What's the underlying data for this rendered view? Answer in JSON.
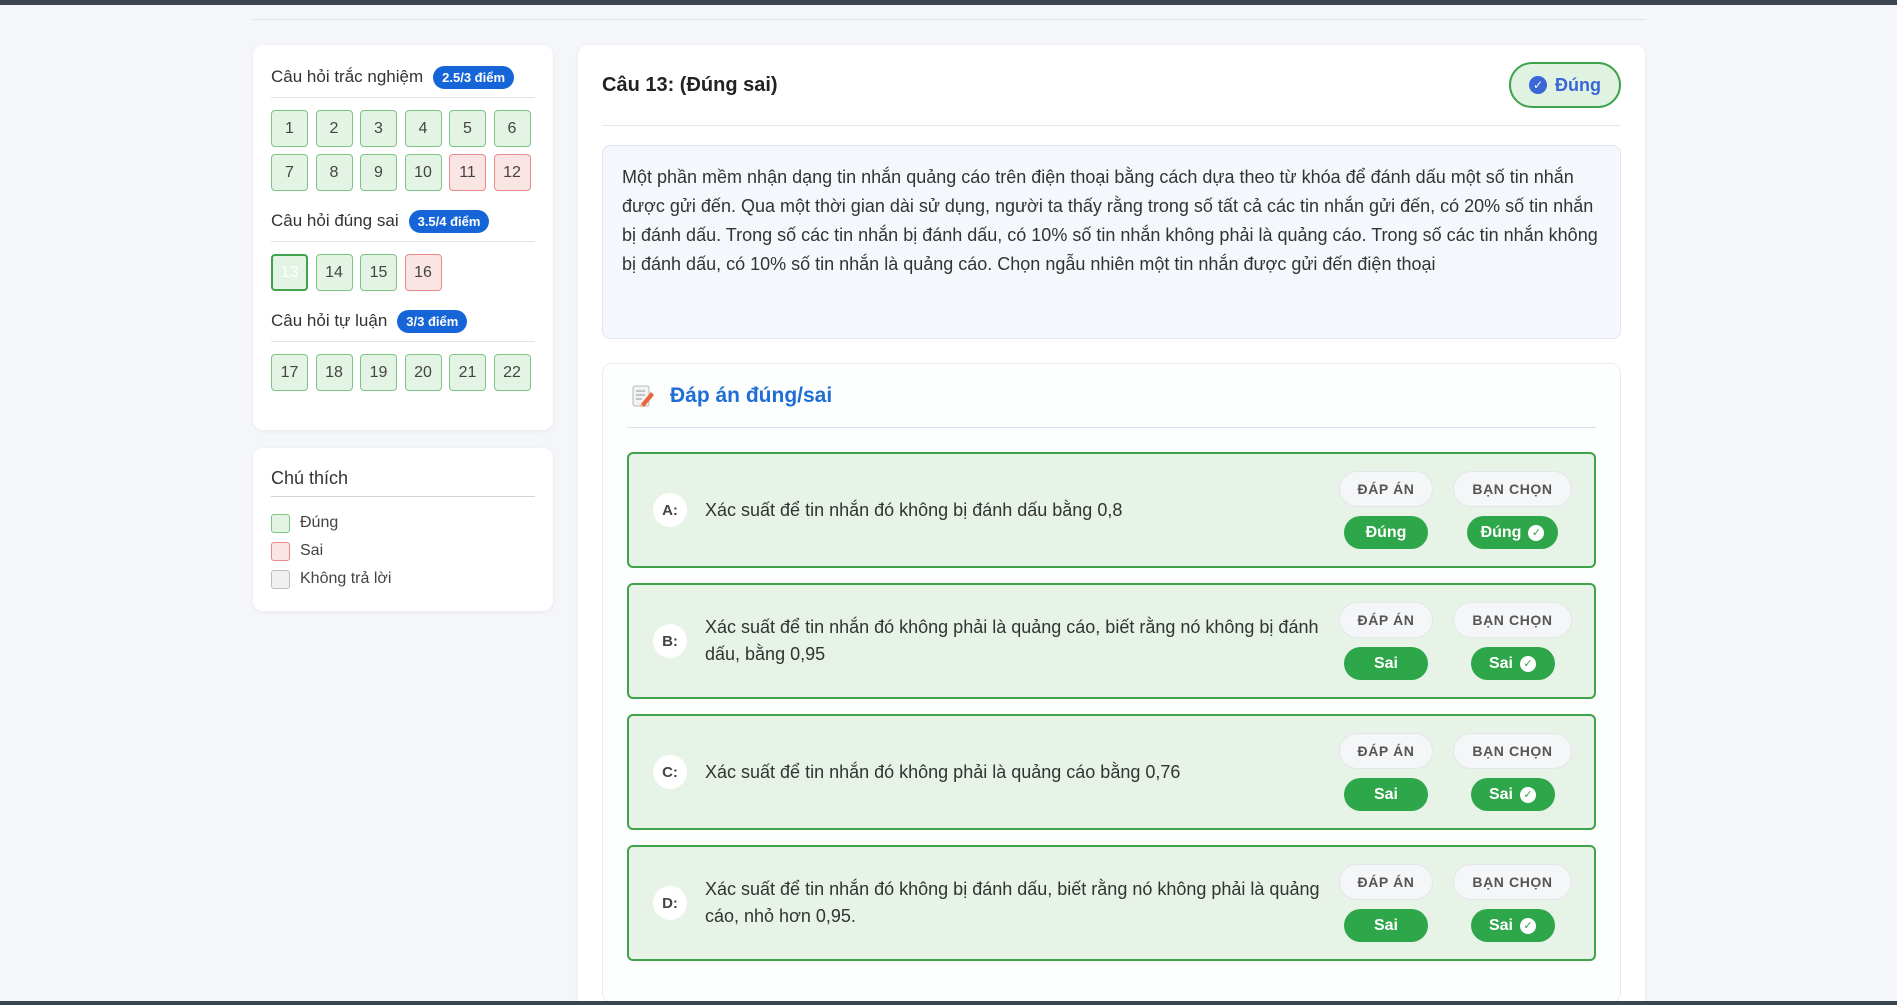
{
  "sidebar": {
    "sections": [
      {
        "title": "Câu hỏi trắc nghiệm",
        "badge": "2.5/3 điểm",
        "items": [
          {
            "label": "1",
            "state": "correct"
          },
          {
            "label": "2",
            "state": "correct"
          },
          {
            "label": "3",
            "state": "correct"
          },
          {
            "label": "4",
            "state": "correct"
          },
          {
            "label": "5",
            "state": "correct"
          },
          {
            "label": "6",
            "state": "correct"
          },
          {
            "label": "7",
            "state": "correct"
          },
          {
            "label": "8",
            "state": "correct"
          },
          {
            "label": "9",
            "state": "correct"
          },
          {
            "label": "10",
            "state": "correct"
          },
          {
            "label": "11",
            "state": "wrong"
          },
          {
            "label": "12",
            "state": "wrong"
          }
        ]
      },
      {
        "title": "Câu hỏi đúng sai",
        "badge": "3.5/4 điểm",
        "items": [
          {
            "label": "13",
            "state": "current"
          },
          {
            "label": "14",
            "state": "correct"
          },
          {
            "label": "15",
            "state": "correct"
          },
          {
            "label": "16",
            "state": "wrong"
          }
        ]
      },
      {
        "title": "Câu hỏi tự luận",
        "badge": "3/3 điểm",
        "items": [
          {
            "label": "17",
            "state": "correct"
          },
          {
            "label": "18",
            "state": "correct"
          },
          {
            "label": "19",
            "state": "correct"
          },
          {
            "label": "20",
            "state": "correct"
          },
          {
            "label": "21",
            "state": "correct"
          },
          {
            "label": "22",
            "state": "correct"
          }
        ]
      }
    ]
  },
  "legend": {
    "title": "Chú thích",
    "items": [
      {
        "label": "Đúng",
        "kind": "correct"
      },
      {
        "label": "Sai",
        "kind": "wrong"
      },
      {
        "label": "Không trả lời",
        "kind": "none"
      }
    ]
  },
  "question": {
    "title": "Câu 13: (Đúng sai)",
    "status": "Đúng",
    "prompt": "Một phần mềm nhận dạng tin nhắn quảng cáo trên điện thoại bằng cách dựa theo từ khóa để đánh dấu một số tin nhắn được gửi đến. Qua một thời gian dài sử dụng, người ta thấy rằng trong số tất cả các tin nhắn gửi đến, có 20% số tin nhắn bị đánh dấu. Trong số các tin nhắn bị đánh dấu, có 10% số tin nhắn không phải là quảng cáo. Trong số các tin nhắn không bị đánh dấu, có 10% số tin nhắn là quảng cáo. Chọn ngẫu nhiên một tin nhắn được gửi đến điện thoại"
  },
  "answers": {
    "header": "Đáp án đúng/sai",
    "col_answer": "ĐÁP ÁN",
    "col_choice": "BẠN CHỌN",
    "options": [
      {
        "letter": "A:",
        "text": "Xác suất để tin nhắn đó không bị đánh dấu bằng 0,8",
        "answer": "Đúng",
        "choice": "Đúng"
      },
      {
        "letter": "B:",
        "text": "Xác suất để tin nhắn đó không phải là quảng cáo, biết rằng nó không bị đánh dấu, bằng 0,95",
        "answer": "Sai",
        "choice": "Sai"
      },
      {
        "letter": "C:",
        "text": "Xác suất để tin nhắn đó không phải là quảng cáo bằng 0,76",
        "answer": "Sai",
        "choice": "Sai"
      },
      {
        "letter": "D:",
        "text": "Xác suất để tin nhắn đó không bị đánh dấu, biết rằng nó không phải là quảng cáo, nhỏ hơn 0,95.",
        "answer": "Sai",
        "choice": "Sai"
      }
    ]
  },
  "colors": {
    "correct": "#3ea34a",
    "wrong": "#e58b8b",
    "accent": "#1565d8",
    "status": "#3b66d6"
  }
}
